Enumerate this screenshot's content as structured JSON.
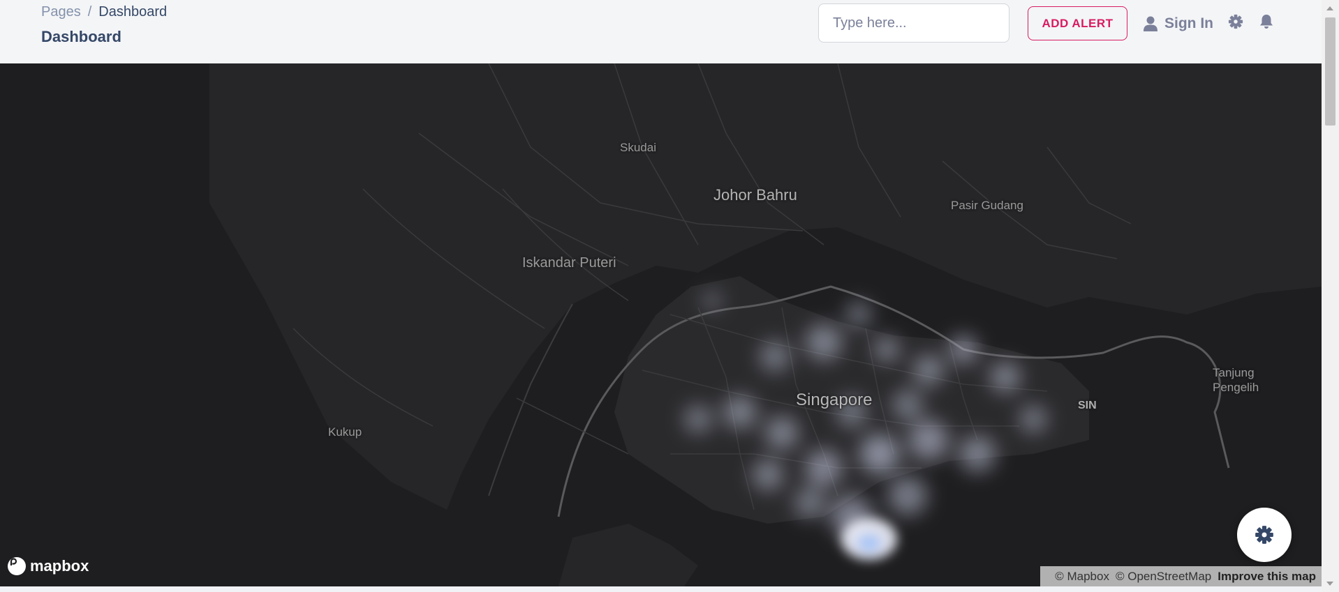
{
  "breadcrumb": {
    "root": "Pages",
    "separator": "/",
    "current": "Dashboard"
  },
  "page_title": "Dashboard",
  "search": {
    "placeholder": "Type here..."
  },
  "header": {
    "add_alert_label": "ADD ALERT",
    "sign_in_label": "Sign In",
    "icons": [
      "user-icon",
      "gear-icon",
      "bell-icon"
    ]
  },
  "map": {
    "provider_logo": "mapbox",
    "place_labels": {
      "skudai": "Skudai",
      "johor_bahru": "Johor Bahru",
      "pasir_gudang": "Pasir Gudang",
      "iskandar_puteri": "Iskandar Puteri",
      "singapore": "Singapore",
      "kukup": "Kukup",
      "sin": "SIN",
      "tanjung_pengelih_1": "Tanjung",
      "tanjung_pengelih_2": "Pengelih"
    },
    "attribution": {
      "mapbox": "© Mapbox",
      "osm": "© OpenStreetMap",
      "improve": "Improve this map"
    },
    "layer": "heatmap",
    "style": "dark"
  },
  "fab": {
    "icon": "gear-icon"
  },
  "colors": {
    "accent": "#d81b60",
    "text_dark": "#344767",
    "text_muted": "#8392ab",
    "map_background": "#1e1e20",
    "heat_core": "#a9c4f5"
  }
}
